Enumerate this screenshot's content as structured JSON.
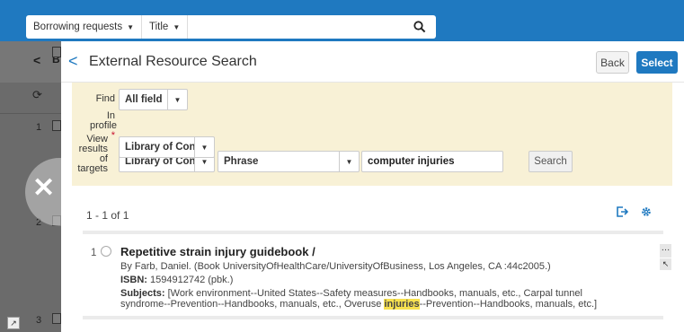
{
  "topbar": {
    "scope_label": "Borrowing requests",
    "field_label": "Title",
    "search_value": "",
    "search_placeholder": ""
  },
  "background": {
    "back_label": "B",
    "row_numbers": [
      "1",
      "2",
      "3"
    ]
  },
  "panel": {
    "title": "External Resource Search",
    "back_button": "Back",
    "select_button": "Select"
  },
  "form": {
    "find_label": "Find",
    "find_value": "All field",
    "in_profile_label": "In profile",
    "required_mark": "*",
    "profile_value": "Library of Con",
    "phrase_value": "Phrase",
    "query_value": "computer injuries",
    "search_button": "Search",
    "view_label": "View results of targets",
    "view_value": "Library of Con"
  },
  "results": {
    "count": "1 - 1 of 1",
    "items": [
      {
        "num": "1",
        "title": "Repetitive strain injury guidebook /",
        "byline": "By Farb, Daniel. (Book UniversityOfHealthCare/UniversityOfBusiness, Los Angeles, CA :44c2005.)",
        "isbn_label": "ISBN:",
        "isbn": "1594912742 (pbk.)",
        "subjects_label": "Subjects:",
        "subjects_a": "[Work environment--United States--Safety measures--Handbooks, manuals, etc., Carpal tunnel",
        "subjects_b1": "syndrome--Prevention--Handbooks, manuals, etc., Overuse ",
        "subjects_hl": "injuries",
        "subjects_b2": "--Prevention--Handbooks, manuals, etc.]"
      }
    ]
  },
  "colors": {
    "brand_blue": "#1f79c0",
    "form_bg": "#f8f1d6",
    "highlight": "#f7e14f",
    "required": "#c8102e"
  },
  "icons": [
    "search-icon",
    "caret-down-icon",
    "chevron-left-icon",
    "close-icon",
    "refresh-icon",
    "export-icon",
    "gear-icon",
    "more-icon",
    "pin-icon",
    "expand-icon"
  ]
}
